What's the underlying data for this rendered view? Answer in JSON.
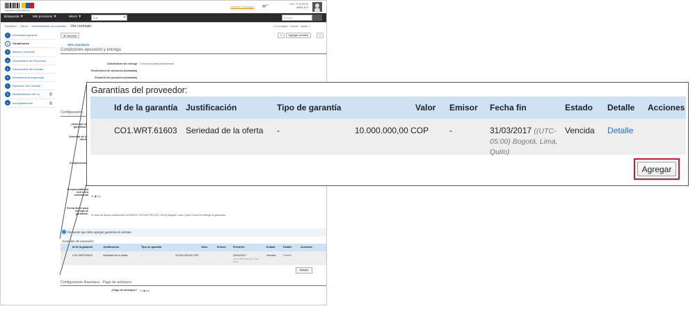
{
  "header": {
    "logo_text": "Colombia Compra Eficiente",
    "top_link": "Ambiente Ejecutando",
    "notifications_count": "10",
    "clock": "UTC -5 10:03:25",
    "date": "MMM 30 ▾"
  },
  "nav": {
    "items": [
      "Búsqueda ▼",
      "Mis procesos ▼",
      "Menú ▼"
    ],
    "select_value": "Ir a",
    "search_placeholder": "Buscar"
  },
  "breadcrumb": {
    "trail": "Escritorio → Menú → Administración de contratos →",
    "current": "Ver contrato",
    "page_links": "Ir a la página  · Versión  ·  Ayuda ⓘ"
  },
  "sidebar": {
    "items": [
      {
        "num": "1",
        "label": "Información general"
      },
      {
        "num": "2",
        "label": "Condiciones"
      },
      {
        "num": "3",
        "label": "Bienes y servicios"
      },
      {
        "num": "4",
        "label": "Documentos del Proveedor"
      },
      {
        "num": "5",
        "label": "Documentos del contrato"
      },
      {
        "num": "6",
        "label": "Información presupuestal"
      },
      {
        "num": "7",
        "label": "Ejecución del Contrato"
      },
      {
        "num": "8",
        "label": "Modificaciones del Co"
      },
      {
        "num": "9",
        "label": "Incumplimientos"
      }
    ],
    "active_index": 1
  },
  "toolbar": {
    "cancel_label": "Cancelar",
    "prev_label": "<",
    "add_contract_label": "Agregar contrato",
    "next_label": ">"
  },
  "conditions": {
    "tag": "VER CONTRATO",
    "section_title": "Condiciones ejecución y entrega",
    "rows": [
      {
        "label": "Condiciones de entrega",
        "value": "Como acordado previamente"
      },
      {
        "label": "Fecha inicio de ejecución (estimada)",
        "value": "-"
      },
      {
        "label": "Fecha fin de ejecución (estimada)",
        "value": "-"
      }
    ],
    "config_title": "Configuración",
    "partial_labels": [
      "¿Solicitud de garantías?",
      "Seriedad de la oferta",
      "Cumplimiento",
      "Responsabilidad civil extra contractual"
    ],
    "radio_text": "Sí  ◉ No",
    "deadline_label": "Fecha límite para entrega de garantías:",
    "deadline_value": "21 días de tiempo transcurrido 14/03/2017 09:03:00 PM (UTC-05:00) Bogotá, Lima, Quito  Fecha de entrega de garantías -"
  },
  "notice": {
    "text": "Recuerde que debe agregar garantías al contrato"
  },
  "guarantees": {
    "title": "Garantías del proveedor:",
    "columns": [
      "Id de la garantía",
      "Justificación",
      "Tipo de garantía",
      "Valor",
      "Emisor",
      "Fecha fin",
      "Estado",
      "Detalle",
      "Acciones"
    ],
    "rows": [
      {
        "id": "CO1.WRT.61603",
        "justification": "Seriedad de la oferta",
        "type": "-",
        "value": "10.000.000,00 COP",
        "issuer": "-",
        "end_date": "31/03/2017",
        "timezone": "((UTC-05:00) Bogotá, Lima, Quito)",
        "status": "Vencida",
        "detail_link": "Detalle"
      }
    ],
    "add_button": "Agregar"
  },
  "financial": {
    "title": "Configuración financiera - Pago de anticipos",
    "question": "¿Pago de anticipos?",
    "radio_text": "Sí  ◉ No"
  }
}
